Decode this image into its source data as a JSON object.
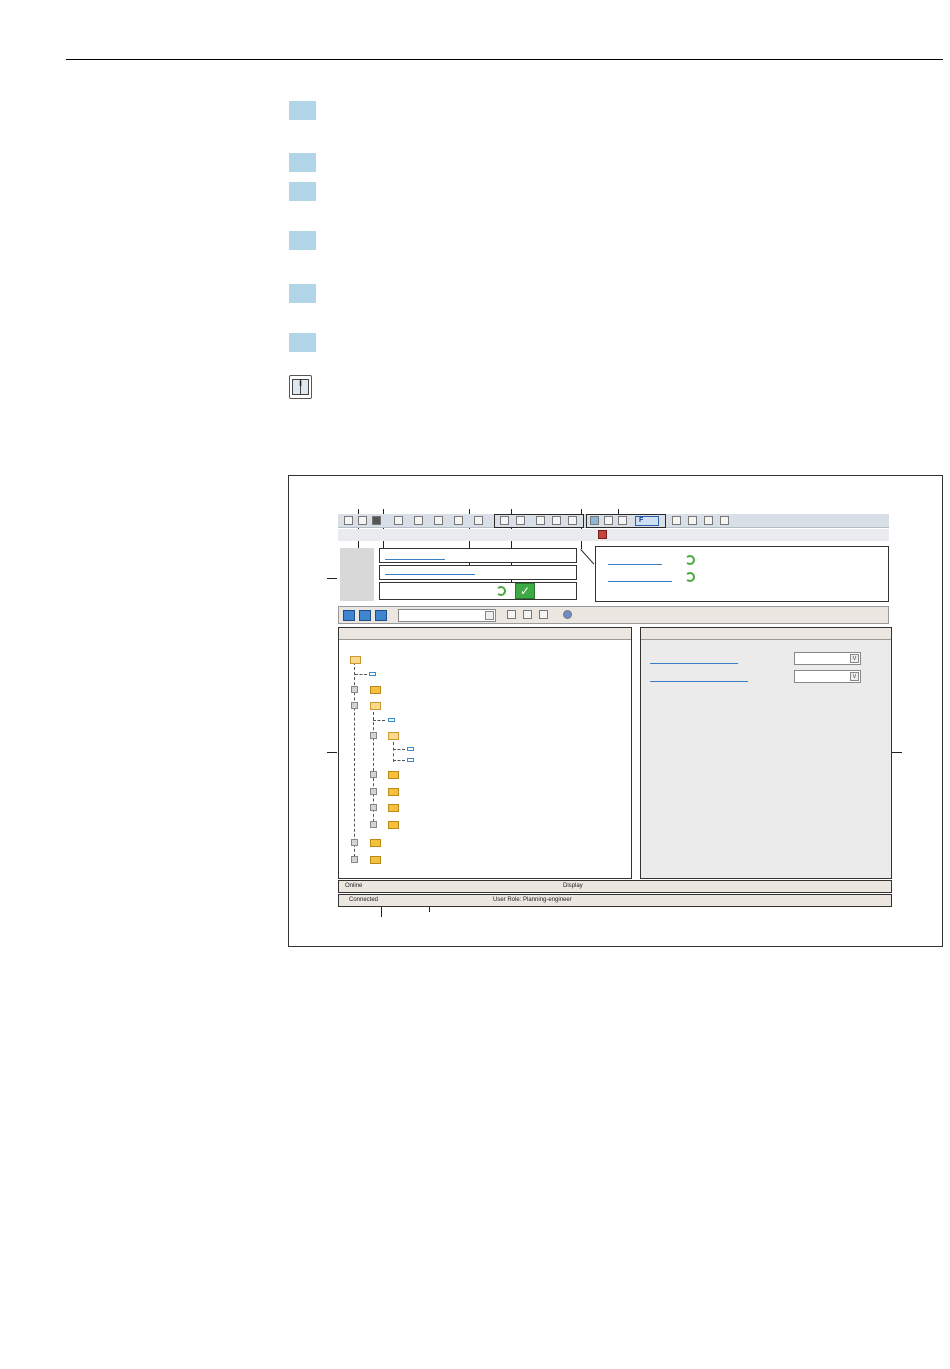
{
  "steps": {
    "count": 6
  },
  "figure": {
    "tabs": {
      "online_label": "Online",
      "display_label": "Display"
    },
    "status_bar": {
      "connected_label": "Connected",
      "user_role": "User Role: Planning-engineer"
    },
    "toolbar": {
      "function_button": "F"
    },
    "colors": {
      "step_marker": "#b3d5e8",
      "link": "#3a7fc4",
      "folder": "#f5c13c",
      "ok_green": "#3eaa45"
    }
  }
}
